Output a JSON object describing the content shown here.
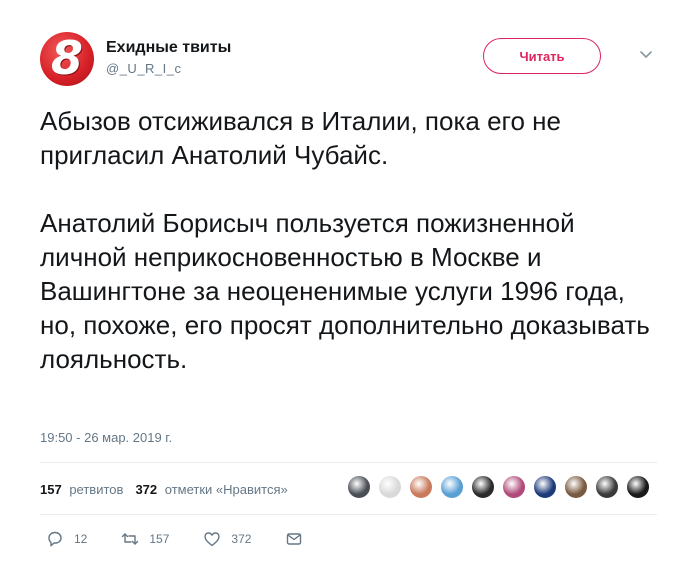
{
  "account": {
    "display_name": "Ехидные твиты",
    "handle": "@_U_R_I_c",
    "avatar_glyph": "8"
  },
  "follow_button_label": "Читать",
  "tweet": {
    "text": "Абызов отсиживался в Италии, пока его не пригласил Анатолий Чубайс.\n\nАнатолий Борисыч пользуется пожизненной личной неприкосновенностью в Москве и Вашингтоне за неоцененимые услуги 1996 года, но, похоже, его просят дополнительно доказывать лояльность.",
    "timestamp": "19:50 - 26 мар. 2019 г."
  },
  "stats": {
    "retweets_count": "157",
    "retweets_label": "ретвитов",
    "likes_count": "372",
    "likes_label": "отметки «Нравится»"
  },
  "likers": [
    {
      "color": "#4a4f57",
      "icon": "avatar-icon"
    },
    {
      "color": "#d9d9d9",
      "icon": "avatar-icon"
    },
    {
      "color": "#c87a5a",
      "icon": "avatar-icon"
    },
    {
      "color": "#5a9fd4",
      "icon": "avatar-icon"
    },
    {
      "color": "#2b2b2b",
      "icon": "avatar-icon"
    },
    {
      "color": "#b04a7a",
      "icon": "avatar-icon"
    },
    {
      "color": "#1f3a7a",
      "icon": "avatar-icon"
    },
    {
      "color": "#7a5a40",
      "icon": "avatar-icon"
    },
    {
      "color": "#3a3a3a",
      "icon": "avatar-icon"
    },
    {
      "color": "#1a1a1a",
      "icon": "avatar-icon"
    }
  ],
  "actions": {
    "reply_count": "12",
    "retweet_count": "157",
    "like_count": "372"
  },
  "colors": {
    "accent": "#e0245e",
    "text": "#14171a",
    "muted": "#657786",
    "avatar_red": "#d61f26"
  }
}
